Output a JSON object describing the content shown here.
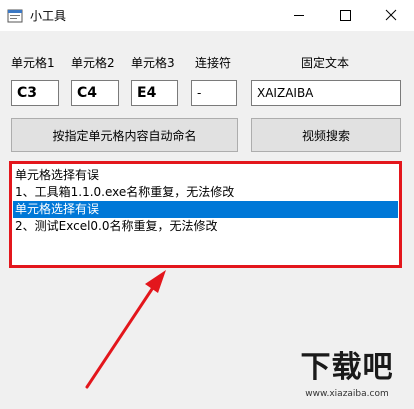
{
  "window": {
    "title": "小工具"
  },
  "labels": {
    "cell1": "单元格1",
    "cell2": "单元格2",
    "cell3": "单元格3",
    "connector": "连接符",
    "fixed_text": "固定文本"
  },
  "fields": {
    "cell1": "C3",
    "cell2": "C4",
    "cell3": "E4",
    "connector": "-",
    "fixed_text": "XAIZAIBA"
  },
  "buttons": {
    "rename": "按指定单元格内容自动命名",
    "video_search": "视频搜索"
  },
  "log": {
    "lines": [
      "单元格选择有误",
      "1、工具箱1.1.0.exe名称重复，无法修改",
      "单元格选择有误",
      "2、测试Excel0.0名称重复，无法修改"
    ],
    "selected_index": 2
  },
  "annotation": {
    "color": "#e3161c"
  },
  "watermark": {
    "text": "下载吧",
    "url": "www.xiazaiba.com"
  },
  "colors": {
    "selection": "#0078d7",
    "annotation": "#e3161c",
    "window_bg": "#f0f0f0"
  }
}
